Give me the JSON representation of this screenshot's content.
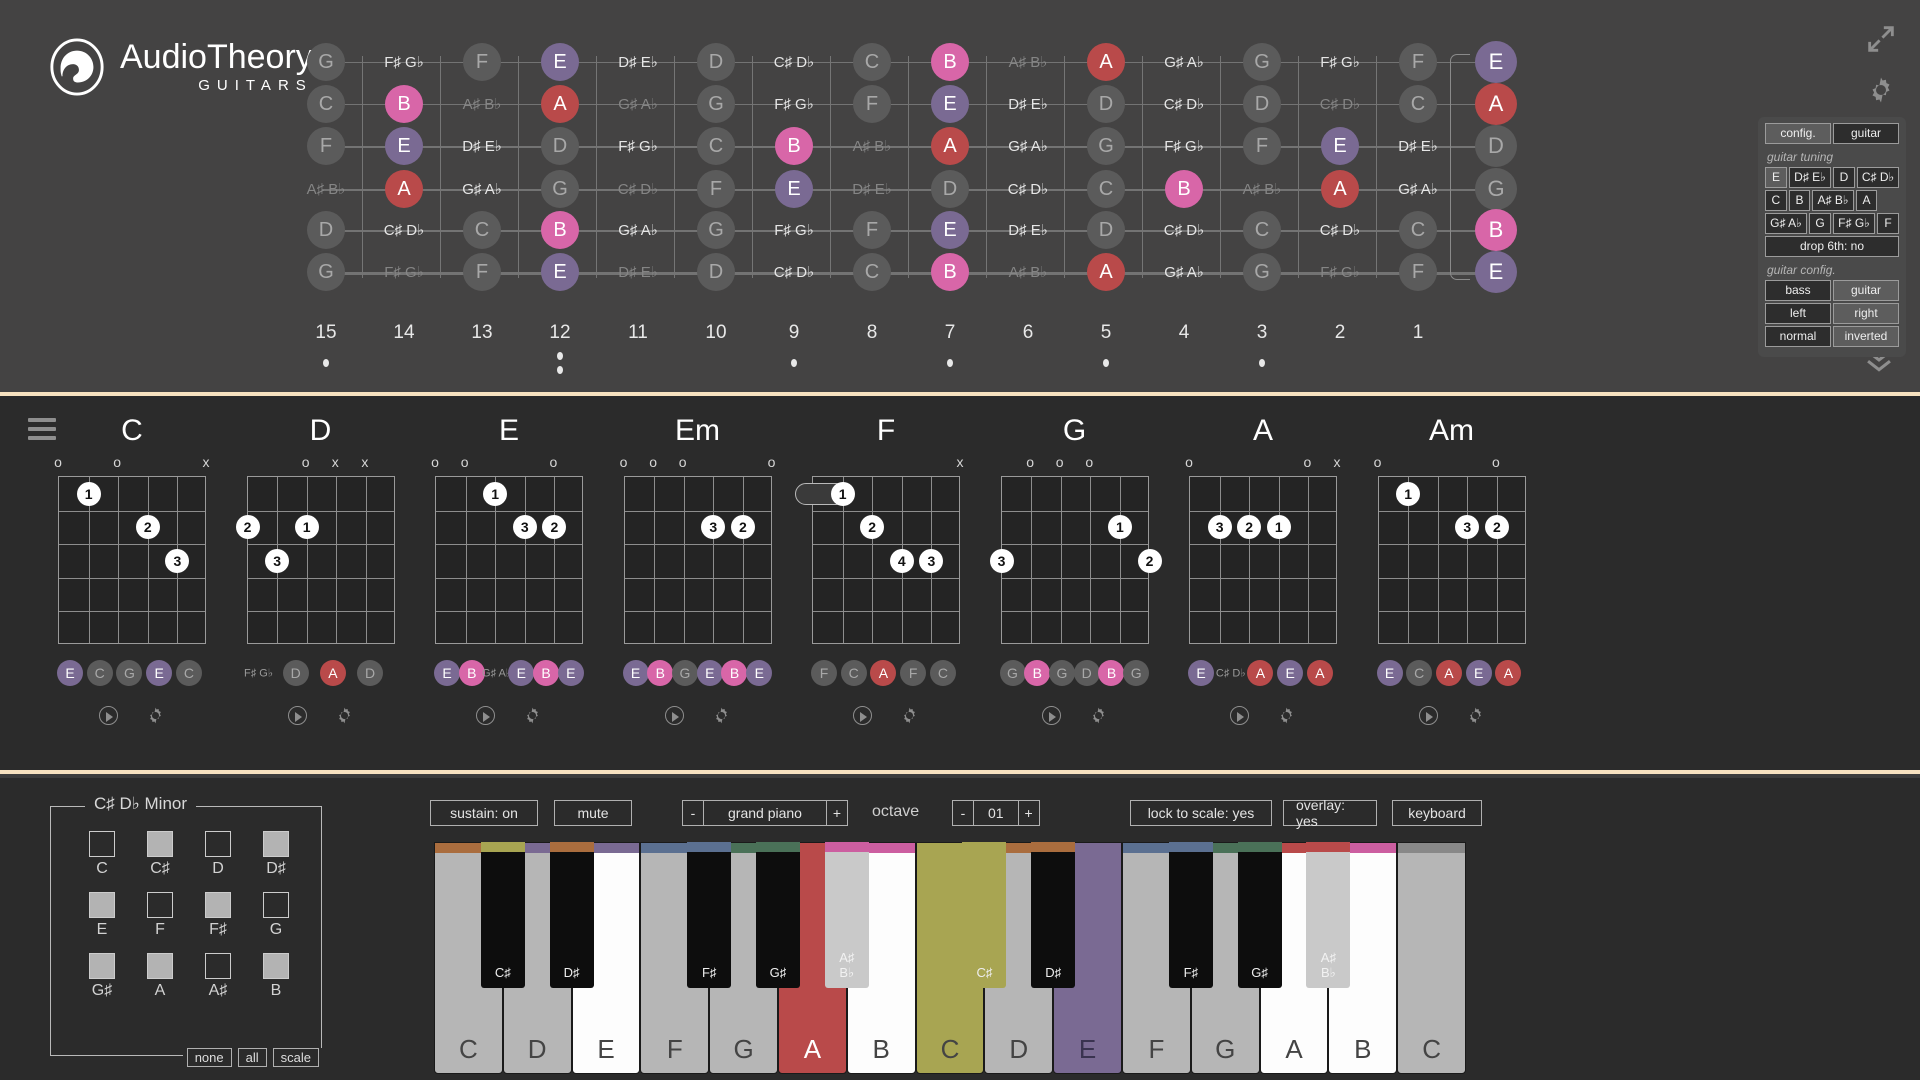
{
  "app": {
    "title_line1": "AudioTheory",
    "title_line2": "GUITARS"
  },
  "topbar": {
    "expand_icon": "expand-icon",
    "gear_icon": "gear-icon",
    "chevron_icon": "chevron-double-down-icon"
  },
  "fretboard": {
    "strings": 6,
    "fret_numbers": [
      "15",
      "14",
      "13",
      "12",
      "11",
      "10",
      "9",
      "8",
      "7",
      "6",
      "5",
      "4",
      "3",
      "2",
      "1"
    ],
    "marker_frets": [
      15,
      12,
      9,
      7,
      5,
      3
    ],
    "double_marker_fret": 12,
    "open_strings": [
      "E",
      "A",
      "D",
      "G",
      "B",
      "E"
    ],
    "open_string_colors": [
      "purple",
      "red",
      "dim",
      "dim",
      "pink",
      "purple"
    ],
    "rows": [
      [
        "G",
        "F♯ G♭",
        "F",
        "E",
        "D♯ E♭",
        "D",
        "C♯ D♭",
        "C",
        "B",
        "A♯ B♭",
        "A",
        "G♯ A♭",
        "G",
        "F♯ G♭",
        "F",
        "E"
      ],
      [
        "C",
        "B",
        "A♯ B♭",
        "A",
        "G♯ A♭",
        "G",
        "F♯ G♭",
        "F",
        "E",
        "D♯ E♭",
        "D",
        "C♯ D♭",
        "D",
        "C♯ D♭",
        "C",
        "A"
      ],
      [
        "F",
        "E",
        "D♯ E♭",
        "D",
        "F♯ G♭",
        "C",
        "B",
        "A♯ B♭",
        "A",
        "G♯ A♭",
        "G",
        "F♯ G♭",
        "F",
        "E",
        "D♯ E♭",
        "D"
      ],
      [
        "A♯ B♭",
        "A",
        "G♯ A♭",
        "G",
        "C♯ D♭",
        "F",
        "E",
        "D♯ E♭",
        "D",
        "C♯ D♭",
        "C",
        "B",
        "A♯ B♭",
        "A",
        "G♯ A♭",
        "G"
      ],
      [
        "D",
        "C♯ D♭",
        "C",
        "B",
        "G♯ A♭",
        "G",
        "F♯ G♭",
        "F",
        "E",
        "D♯ E♭",
        "D",
        "C♯ D♭",
        "C",
        "C♯ D♭",
        "C",
        "B"
      ],
      [
        "G",
        "F♯ G♭",
        "F",
        "E",
        "D♯ E♭",
        "D",
        "C♯ D♭",
        "C",
        "B",
        "A♯ B♭",
        "A",
        "G♯ A♭",
        "G",
        "F♯ G♭",
        "F",
        "E"
      ]
    ]
  },
  "config_panel": {
    "mode_tabs": [
      {
        "label": "config.",
        "active": true
      },
      {
        "label": "guitar",
        "active": false
      }
    ],
    "tuning_heading": "guitar tuning",
    "tuning_rows": [
      [
        {
          "label": "E",
          "w": 1,
          "on": true
        },
        {
          "label": "D♯ E♭",
          "w": 2,
          "on": false
        },
        {
          "label": "D",
          "w": 1,
          "on": false
        },
        {
          "label": "C♯ D♭",
          "w": 2,
          "on": false
        }
      ],
      [
        {
          "label": "C",
          "w": 1,
          "on": false
        },
        {
          "label": "B",
          "w": 1,
          "on": false
        },
        {
          "label": "A♯ B♭",
          "w": 2,
          "on": false
        },
        {
          "label": "A",
          "w": 1,
          "on": false
        },
        {
          "label": "",
          "w": 1,
          "on": false,
          "blank": true
        }
      ],
      [
        {
          "label": "G♯ A♭",
          "w": 2,
          "on": false
        },
        {
          "label": "G",
          "w": 1,
          "on": false
        },
        {
          "label": "F♯ G♭",
          "w": 2,
          "on": false
        },
        {
          "label": "F",
          "w": 1,
          "on": false
        }
      ]
    ],
    "drop_label": "drop 6th: no",
    "config_heading": "guitar config.",
    "config_rows": [
      [
        {
          "label": "bass",
          "on": false
        },
        {
          "label": "guitar",
          "on": true
        }
      ],
      [
        {
          "label": "left",
          "on": false
        },
        {
          "label": "right",
          "on": true
        }
      ],
      [
        {
          "label": "normal",
          "on": false
        },
        {
          "label": "inverted",
          "on": true
        }
      ]
    ]
  },
  "chords": [
    {
      "name": "C",
      "marks": [
        {
          "sym": "o",
          "s": 0
        },
        {
          "sym": "o",
          "s": 2
        },
        {
          "sym": "x",
          "s": 5
        }
      ],
      "fingers": [
        {
          "n": "1",
          "s": 1,
          "f": 1
        },
        {
          "n": "2",
          "s": 3,
          "f": 2
        },
        {
          "n": "3",
          "s": 4,
          "f": 3
        }
      ],
      "barre": null,
      "notes": [
        {
          "t": "E",
          "c": "purple"
        },
        {
          "t": "C",
          "c": "dim"
        },
        {
          "t": "G",
          "c": "dim"
        },
        {
          "t": "E",
          "c": "purple"
        },
        {
          "t": "C",
          "c": "dim"
        }
      ]
    },
    {
      "name": "D",
      "marks": [
        {
          "sym": "o",
          "s": 2
        },
        {
          "sym": "x",
          "s": 3
        },
        {
          "sym": "x",
          "s": 4
        }
      ],
      "fingers": [
        {
          "n": "2",
          "s": 0,
          "f": 2
        },
        {
          "n": "1",
          "s": 2,
          "f": 2
        },
        {
          "n": "3",
          "s": 1,
          "f": 3
        }
      ],
      "barre": null,
      "notes": [
        {
          "t": "F♯ G♭",
          "c": "txt"
        },
        {
          "t": "D",
          "c": "dim"
        },
        {
          "t": "A",
          "c": "red"
        },
        {
          "t": "D",
          "c": "dim"
        }
      ]
    },
    {
      "name": "E",
      "marks": [
        {
          "sym": "o",
          "s": 0
        },
        {
          "sym": "o",
          "s": 1
        },
        {
          "sym": "o",
          "s": 4
        }
      ],
      "fingers": [
        {
          "n": "1",
          "s": 2,
          "f": 1
        },
        {
          "n": "3",
          "s": 3,
          "f": 2
        },
        {
          "n": "2",
          "s": 4,
          "f": 2
        }
      ],
      "barre": null,
      "notes": [
        {
          "t": "E",
          "c": "purple"
        },
        {
          "t": "B",
          "c": "pink"
        },
        {
          "t": "G♯ A♭",
          "c": "txt"
        },
        {
          "t": "E",
          "c": "purple"
        },
        {
          "t": "B",
          "c": "pink"
        },
        {
          "t": "E",
          "c": "purple"
        }
      ]
    },
    {
      "name": "Em",
      "marks": [
        {
          "sym": "o",
          "s": 0
        },
        {
          "sym": "o",
          "s": 1
        },
        {
          "sym": "o",
          "s": 2
        },
        {
          "sym": "o",
          "s": 5
        }
      ],
      "fingers": [
        {
          "n": "3",
          "s": 3,
          "f": 2
        },
        {
          "n": "2",
          "s": 4,
          "f": 2
        }
      ],
      "barre": null,
      "notes": [
        {
          "t": "E",
          "c": "purple"
        },
        {
          "t": "B",
          "c": "pink"
        },
        {
          "t": "G",
          "c": "dim"
        },
        {
          "t": "E",
          "c": "purple"
        },
        {
          "t": "B",
          "c": "pink"
        },
        {
          "t": "E",
          "c": "purple"
        }
      ]
    },
    {
      "name": "F",
      "marks": [
        {
          "sym": "x",
          "s": 5
        }
      ],
      "fingers": [
        {
          "n": "1",
          "s": 1,
          "f": 1
        },
        {
          "n": "2",
          "s": 2,
          "f": 2
        },
        {
          "n": "4",
          "s": 3,
          "f": 3
        },
        {
          "n": "3",
          "s": 4,
          "f": 3
        }
      ],
      "barre": {
        "fret": 1,
        "from": 0,
        "to": 1
      },
      "notes": [
        {
          "t": "F",
          "c": "dim"
        },
        {
          "t": "C",
          "c": "dim"
        },
        {
          "t": "A",
          "c": "red"
        },
        {
          "t": "F",
          "c": "dim"
        },
        {
          "t": "C",
          "c": "dim"
        }
      ]
    },
    {
      "name": "G",
      "marks": [
        {
          "sym": "o",
          "s": 1
        },
        {
          "sym": "o",
          "s": 2
        },
        {
          "sym": "o",
          "s": 3
        }
      ],
      "fingers": [
        {
          "n": "1",
          "s": 4,
          "f": 2
        },
        {
          "n": "3",
          "s": 0,
          "f": 3
        },
        {
          "n": "2",
          "s": 5,
          "f": 3
        }
      ],
      "barre": null,
      "notes": [
        {
          "t": "G",
          "c": "dim"
        },
        {
          "t": "B",
          "c": "pink"
        },
        {
          "t": "G",
          "c": "dim"
        },
        {
          "t": "D",
          "c": "dim"
        },
        {
          "t": "B",
          "c": "pink"
        },
        {
          "t": "G",
          "c": "dim"
        }
      ]
    },
    {
      "name": "A",
      "marks": [
        {
          "sym": "o",
          "s": 0
        },
        {
          "sym": "o",
          "s": 4
        },
        {
          "sym": "x",
          "s": 5
        }
      ],
      "fingers": [
        {
          "n": "3",
          "s": 1,
          "f": 2
        },
        {
          "n": "2",
          "s": 2,
          "f": 2
        },
        {
          "n": "1",
          "s": 3,
          "f": 2
        }
      ],
      "barre": null,
      "notes": [
        {
          "t": "E",
          "c": "purple"
        },
        {
          "t": "C♯ D♭",
          "c": "txt"
        },
        {
          "t": "A",
          "c": "red"
        },
        {
          "t": "E",
          "c": "purple"
        },
        {
          "t": "A",
          "c": "red"
        }
      ]
    },
    {
      "name": "Am",
      "marks": [
        {
          "sym": "o",
          "s": 0
        },
        {
          "sym": "o",
          "s": 4
        }
      ],
      "fingers": [
        {
          "n": "1",
          "s": 1,
          "f": 1
        },
        {
          "n": "3",
          "s": 3,
          "f": 2
        },
        {
          "n": "2",
          "s": 4,
          "f": 2
        }
      ],
      "barre": null,
      "notes": [
        {
          "t": "E",
          "c": "purple"
        },
        {
          "t": "C",
          "c": "dim"
        },
        {
          "t": "A",
          "c": "red"
        },
        {
          "t": "E",
          "c": "purple"
        },
        {
          "t": "A",
          "c": "red"
        }
      ]
    }
  ],
  "scale_panel": {
    "title": "C♯ D♭ Minor",
    "notes": [
      {
        "label": "C",
        "on": false
      },
      {
        "label": "C♯",
        "on": true
      },
      {
        "label": "D",
        "on": false
      },
      {
        "label": "D♯",
        "on": true
      },
      {
        "label": "E",
        "on": true
      },
      {
        "label": "F",
        "on": false
      },
      {
        "label": "F♯",
        "on": true
      },
      {
        "label": "G",
        "on": false
      },
      {
        "label": "G♯",
        "on": true
      },
      {
        "label": "A",
        "on": true
      },
      {
        "label": "A♯",
        "on": false
      },
      {
        "label": "B",
        "on": true
      }
    ],
    "buttons": [
      "none",
      "all",
      "scale"
    ]
  },
  "piano_toolbar": {
    "sustain": "sustain: on",
    "mute": "mute",
    "instrument_minus": "-",
    "instrument": "grand piano",
    "instrument_plus": "+",
    "octave_label": "octave",
    "octave_minus": "-",
    "octave_value": "01",
    "octave_plus": "+",
    "lock_to_scale": "lock to scale: yes",
    "overlay": "overlay: yes",
    "keyboard": "keyboard"
  },
  "piano": {
    "white_keys": [
      {
        "label": "C",
        "state": "grey",
        "top": "#aa6d3e"
      },
      {
        "label": "D",
        "state": "grey",
        "top": "#7a6a93"
      },
      {
        "label": "E",
        "state": "white",
        "top": "#7a6a93"
      },
      {
        "label": "F",
        "state": "grey",
        "top": "#5b7091"
      },
      {
        "label": "G",
        "state": "grey",
        "top": "#4a7158"
      },
      {
        "label": "A",
        "state": "red",
        "top": "#b94a4a"
      },
      {
        "label": "B",
        "state": "white",
        "top": "#cc5ea0"
      },
      {
        "label": "C",
        "state": "grey",
        "top": "#a8a552"
      },
      {
        "label": "D",
        "state": "grey",
        "top": "#aa6d3e"
      },
      {
        "label": "E",
        "state": "purple",
        "top": "#7a6a93"
      },
      {
        "label": "F",
        "state": "grey",
        "top": "#5b7091"
      },
      {
        "label": "G",
        "state": "grey",
        "top": "#4a7158"
      },
      {
        "label": "A",
        "state": "white",
        "top": "#b94a4a"
      },
      {
        "label": "B",
        "state": "white",
        "top": "#cc5ea0"
      },
      {
        "label": "C",
        "state": "grey",
        "top": "#888888"
      }
    ],
    "black_keys": [
      {
        "label": "C♯",
        "after": 0,
        "style": "black",
        "top": "#a8a552"
      },
      {
        "label": "D♯",
        "after": 1,
        "style": "black",
        "top": "#aa6d3e"
      },
      {
        "label": "F♯",
        "after": 3,
        "style": "black",
        "top": "#5b7091"
      },
      {
        "label": "G♯",
        "after": 4,
        "style": "black",
        "top": "#4a7158"
      },
      {
        "label": "A♯\nB♭",
        "after": 5,
        "style": "light",
        "top": "#cc5ea0"
      },
      {
        "label": "C♯",
        "after": 7,
        "style": "black",
        "top": "#a8a552"
      },
      {
        "label": "D♯",
        "after": 8,
        "style": "black",
        "top": "#aa6d3e"
      },
      {
        "label": "F♯",
        "after": 10,
        "style": "black",
        "top": "#5b7091"
      },
      {
        "label": "G♯",
        "after": 11,
        "style": "black",
        "top": "#4a7158"
      },
      {
        "label": "A♯\nB♭",
        "after": 12,
        "style": "light",
        "top": "#b94a4a"
      }
    ],
    "olive_white_index": 7,
    "olive_black_index": 5
  },
  "colors": {
    "accent_border": "#f7e2c0",
    "note_red": "#b94a4a",
    "note_pink": "#d866a8",
    "note_purple": "#7a6a93",
    "note_dim": "#5b5b5b",
    "panel_bg": "#2b2b2b",
    "fretboard_bg": "#444343"
  }
}
